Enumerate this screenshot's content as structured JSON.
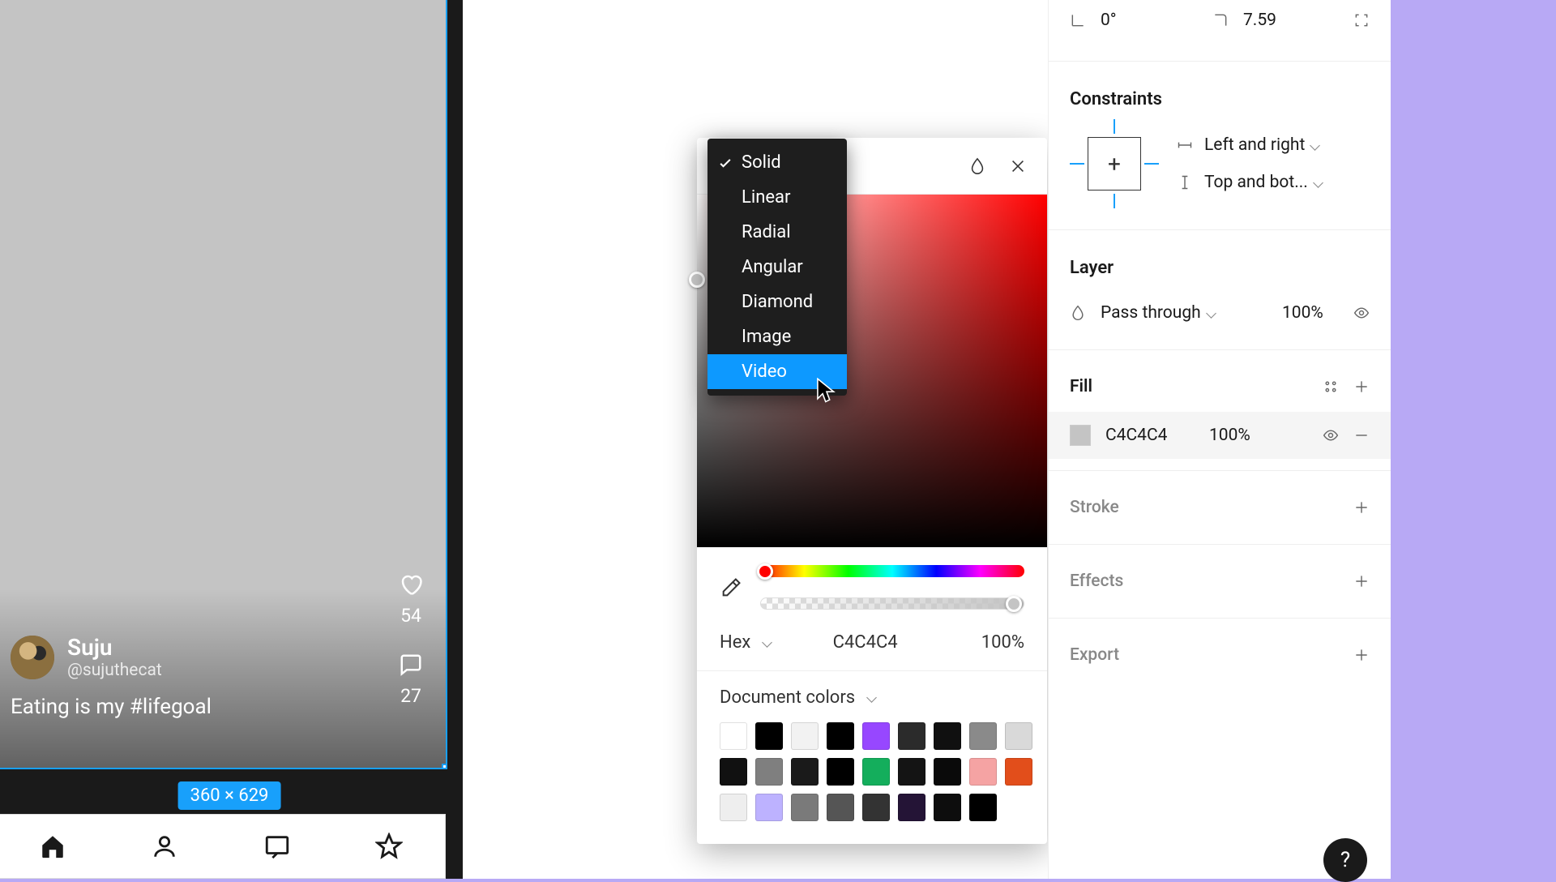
{
  "canvas": {
    "post": {
      "username": "Suju",
      "handle": "@sujuthecat",
      "caption": "Eating is my #lifegoal",
      "likes": "54",
      "comments": "27"
    },
    "selection_size": "360 × 629"
  },
  "colorPicker": {
    "fillTypes": [
      "Solid",
      "Linear",
      "Radial",
      "Angular",
      "Diamond",
      "Image",
      "Video"
    ],
    "fillSelected": "Solid",
    "fillHovered": "Video",
    "format": "Hex",
    "hex": "C4C4C4",
    "opacity": "100%",
    "docColorsTitle": "Document colors",
    "swatches": [
      "#ffffff",
      "#000000",
      "#f2f2f2",
      "#000000",
      "#9747ff",
      "#2b2b2b",
      "#101010",
      "#8a8a8a",
      "#d9d9d9",
      "#111111",
      "#7f7f7f",
      "#1a1a1a",
      "#000000",
      "#14ae5c",
      "#141414",
      "#0a0a0a",
      "#f5a3a3",
      "#e24e1b",
      "#eeeeee",
      "#bdb2ff",
      "#7a7a7a",
      "#555555",
      "#333333",
      "#241436",
      "#0d0d0d",
      "#000000"
    ]
  },
  "panel": {
    "rotation": "0°",
    "cornerRadius": "7.59",
    "constraintsTitle": "Constraints",
    "constraintH": "Left and right",
    "constraintV": "Top and bot...",
    "layerTitle": "Layer",
    "blendMode": "Pass through",
    "layerOpacity": "100%",
    "fillTitle": "Fill",
    "fillHex": "C4C4C4",
    "fillOpacity": "100%",
    "strokeTitle": "Stroke",
    "effectsTitle": "Effects",
    "exportTitle": "Export"
  },
  "help": "?"
}
